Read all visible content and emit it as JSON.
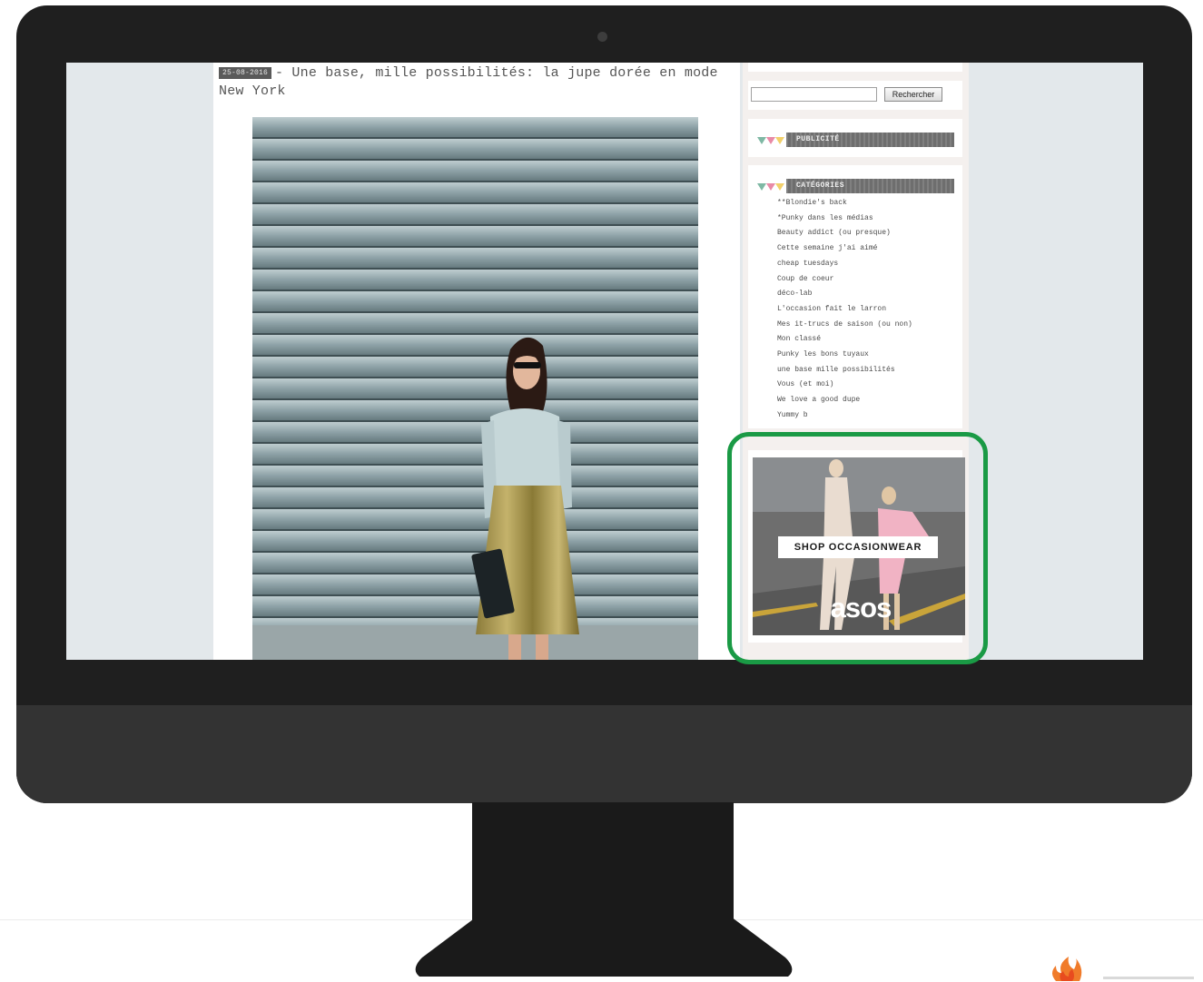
{
  "post": {
    "date": "25-08-2016",
    "title": "- Une base, mille possibilités: la jupe dorée en mode New York"
  },
  "search": {
    "placeholder": "",
    "value": "",
    "button_label": "Rechercher"
  },
  "widgets": {
    "publicite_title": "PUBLICITÉ",
    "categories_title": "CATÉGORIES"
  },
  "categories": [
    "**Blondie's back",
    "*Punky dans les médias",
    "Beauty addict (ou presque)",
    "Cette semaine j'ai aimé",
    "cheap tuesdays",
    "Coup de coeur",
    "déco-lab",
    "L'occasion fait le larron",
    "Mes it-trucs de saison (ou non)",
    "Mon classé",
    "Punky les bons tuyaux",
    "une base mille possibilités",
    "Vous (et moi)",
    "We love a good dupe",
    "Yummy b"
  ],
  "ad": {
    "label": "SHOP OCCASIONWEAR",
    "brand": "asos"
  },
  "colors": {
    "highlight": "#1a9a45",
    "monitor": "#1f1f1f",
    "screen_bg": "#e3e8eb"
  }
}
